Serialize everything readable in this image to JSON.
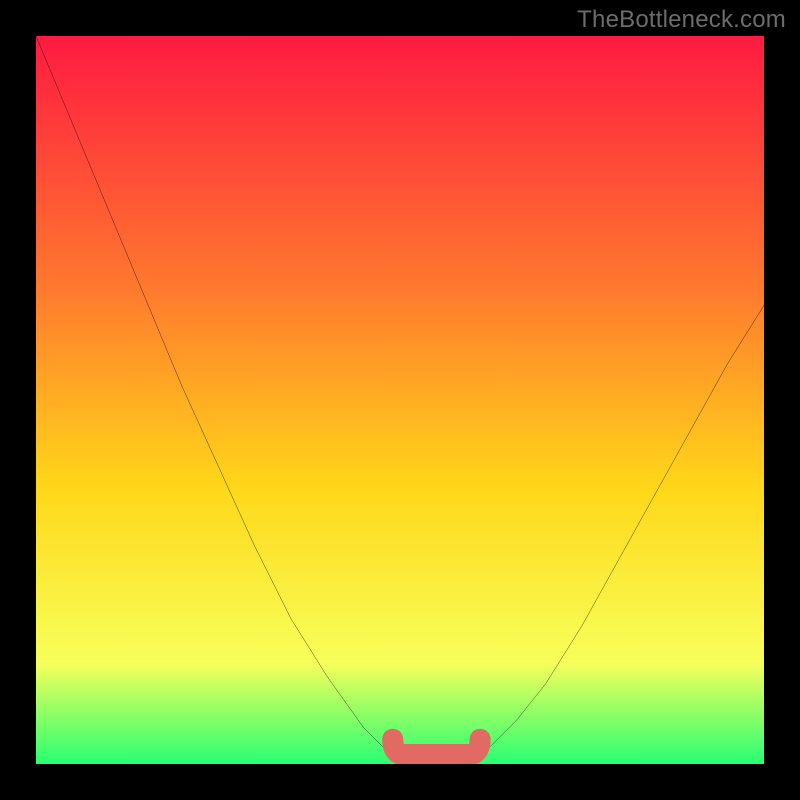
{
  "watermark": "TheBottleneck.com",
  "colors": {
    "background": "#000000",
    "gradient_top": "#ff1a41",
    "gradient_mid1": "#ff7a2e",
    "gradient_mid2": "#ffd719",
    "gradient_mid3": "#f7ff5a",
    "gradient_bottom": "#27ff73",
    "curve": "#000000",
    "flat_marker": "#e16b62",
    "watermark": "#6c6c6c"
  },
  "chart_data": {
    "type": "line",
    "title": "",
    "xlabel": "",
    "ylabel": "",
    "xlim": [
      0,
      100
    ],
    "ylim": [
      0,
      100
    ],
    "x": [
      0,
      5,
      10,
      15,
      20,
      25,
      30,
      35,
      40,
      45,
      48,
      50,
      52,
      54,
      55,
      58,
      60,
      62,
      66,
      70,
      75,
      80,
      85,
      90,
      95,
      100
    ],
    "values": [
      100,
      88,
      76,
      64,
      52,
      41,
      30,
      20,
      12,
      5,
      2,
      1,
      0,
      0,
      0,
      0,
      1,
      2,
      6,
      11,
      19,
      28,
      37,
      46,
      55,
      63
    ],
    "flat_region": {
      "x_start": 49,
      "x_end": 61,
      "y": 0
    },
    "vertex_x": 56
  }
}
